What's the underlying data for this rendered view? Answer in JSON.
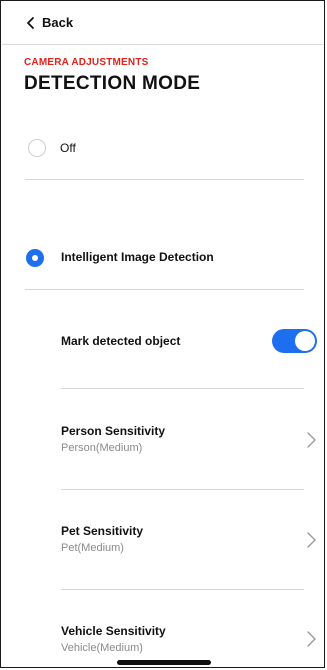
{
  "nav": {
    "back_label": "Back"
  },
  "header": {
    "section": "CAMERA ADJUSTMENTS",
    "title": "DETECTION MODE"
  },
  "options": [
    {
      "label": "Off",
      "selected": false
    },
    {
      "label": "Intelligent Image Detection",
      "selected": true
    }
  ],
  "settings": {
    "mark_detected": {
      "label": "Mark detected object",
      "enabled": true
    },
    "rows": [
      {
        "title": "Person Sensitivity",
        "value": "Person(Medium)"
      },
      {
        "title": "Pet Sensitivity",
        "value": "Pet(Medium)"
      },
      {
        "title": "Vehicle Sensitivity",
        "value": "Vehicle(Medium)"
      }
    ]
  },
  "colors": {
    "accent": "#1e6ff0",
    "section_red": "#e2231a",
    "subtext": "#8a8a8a"
  },
  "icons": {
    "back": "chevron-left-icon",
    "row": "chevron-right-icon"
  }
}
